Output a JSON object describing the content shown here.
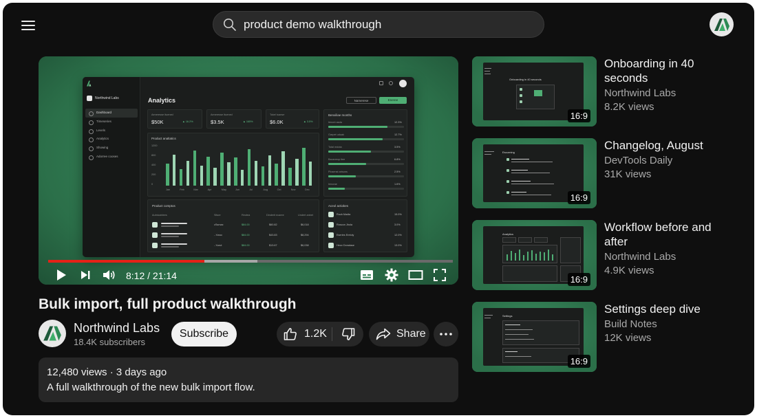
{
  "search": {
    "value": "product demo walkthrough",
    "icon": "search-icon"
  },
  "colors": {
    "accent_green": "#2f7d52",
    "progress_red": "#e62117",
    "background": "#0f0f0f"
  },
  "player": {
    "time": "8:12 / 21:14",
    "progress_played": 0.386,
    "progress_buffered": 0.517,
    "screen": {
      "brand": "Northwind Labs",
      "title": "Analytics",
      "nav": [
        "Dashboard",
        "Timeseries",
        "Levels",
        "Analytics",
        "Showing",
        "Adorree cooses"
      ],
      "pill_dropdown": "Namerese",
      "pill_button": "Eneree",
      "stats": [
        {
          "label": "Aeneresse ituened",
          "value": "$50K",
          "badge": "▲ 16.2%"
        },
        {
          "label": "Aeneresse ituened",
          "value": "$3.5K",
          "badge": "▲ 165%"
        },
        {
          "label": "Tokel tuanse",
          "value": "$6.0K",
          "badge": "▲ 3.5%"
        }
      ],
      "chart_title": "Product analtatics",
      "chart_y_ticks": [
        "1200",
        "800",
        "400",
        "200",
        "0"
      ],
      "chart_months": [
        "Jan",
        "Feb",
        "Mar",
        "Apr",
        "May",
        "Jun",
        "Jul",
        "Aug",
        "Oct",
        "Nov",
        "Dec"
      ],
      "right_title": "Benxiliae months",
      "right_rows": [
        {
          "label": "Ienont asda",
          "value": "12.3%",
          "pct": 0.78
        },
        {
          "label": "Oarpet uduak",
          "value": "12.7%",
          "pct": 0.72
        },
        {
          "label": "Total mdota",
          "value": "3.5%",
          "pct": 0.56
        },
        {
          "label": "Bausneop tiee",
          "value": "6.8%",
          "pct": 0.5
        },
        {
          "label": "Plosenst arisons",
          "value": "2.5%",
          "pct": 0.36
        },
        {
          "label": "Ienorae",
          "value": "1.6%",
          "pct": 0.22
        }
      ],
      "table_title": "Product comptos",
      "table_headers": [
        "Autnicablees",
        "Sitser",
        "Reotea",
        "Dinderit ecaree",
        "Undert anbet"
      ],
      "table_rows": [
        {
          "c2": "cSsmax",
          "c3": "$84.00",
          "c4": "$60.82",
          "c5": "$6,018"
        },
        {
          "c2": "- Xmoc",
          "c3": "$84.00",
          "c4": "$43.83",
          "c5": "$8,294"
        },
        {
          "c2": "- Xorut",
          "c3": "$84.00",
          "c4": "$13.67",
          "c5": "$6,038"
        }
      ],
      "actions_title": "Aceol actiokes",
      "actions": [
        {
          "label": "Rucb Madia",
          "value": "15.0%"
        },
        {
          "label": "Roscon Jbola",
          "value": "3.0%"
        },
        {
          "label": "Eseries Ereloly",
          "value": "12.0%"
        },
        {
          "label": "Heuv Donalase",
          "value": "13.0%"
        }
      ]
    }
  },
  "video": {
    "title": "Bulk import, full product walkthrough",
    "channel": "Northwind Labs",
    "subscribers": "18.4K subscribers",
    "subscribe_label": "Subscribe",
    "likes": "1.2K",
    "share_label": "Share",
    "meta": "12,480 views · 3 days ago",
    "description": "A full walkthrough of the new bulk import flow."
  },
  "recommendations": [
    {
      "title": "Onboarding in 40 seconds",
      "channel": "Northwind Labs",
      "views": "8.2K views",
      "duration": "16:9",
      "thumb_text": "Onboarding in 40 seconds"
    },
    {
      "title": "Changelog, August",
      "channel": "DevTools Daily",
      "views": "31K views",
      "duration": "16:9",
      "thumb_text": "Escurning"
    },
    {
      "title": "Workflow before and after",
      "channel": "Northwind Labs",
      "views": "4.9K views",
      "duration": "16:9",
      "thumb_text": "Analytics"
    },
    {
      "title": "Settings deep dive",
      "channel": "Build Notes",
      "views": "12K views",
      "duration": "16:9",
      "thumb_text": "Settings"
    }
  ]
}
